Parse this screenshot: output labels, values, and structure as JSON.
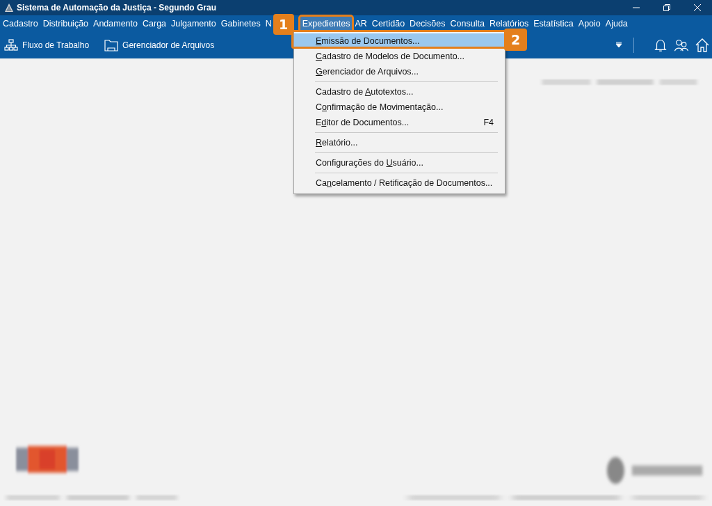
{
  "window": {
    "title": "Sistema de Automação da Justiça - Segundo Grau"
  },
  "menu_bar": [
    {
      "label": "Cadastro",
      "selected": false
    },
    {
      "label": "Distribuição",
      "selected": false
    },
    {
      "label": "Andamento",
      "selected": false
    },
    {
      "label": "Carga",
      "selected": false
    },
    {
      "label": "Julgamento",
      "selected": false
    },
    {
      "label": "Gabinetes",
      "selected": false
    },
    {
      "label": "N",
      "selected": false
    },
    {
      "label": "Expedientes",
      "selected": true
    },
    {
      "label": "AR",
      "selected": false
    },
    {
      "label": "Certidão",
      "selected": false
    },
    {
      "label": "Decisões",
      "selected": false
    },
    {
      "label": "Consulta",
      "selected": false
    },
    {
      "label": "Relatórios",
      "selected": false
    },
    {
      "label": "Estatística",
      "selected": false
    },
    {
      "label": "Apoio",
      "selected": false
    },
    {
      "label": "Ajuda",
      "selected": false
    }
  ],
  "toolbar": [
    {
      "kind": "workflow",
      "label": "Fluxo de Trabalho"
    },
    {
      "kind": "files",
      "label": "Gerenciador de Arquivos"
    }
  ],
  "dropdown_menu": [
    {
      "kind": "item",
      "key": "E",
      "post": "missão de Documentos...",
      "selected": true
    },
    {
      "kind": "item",
      "key": "C",
      "post": "adastro de Modelos de Documento...",
      "selected": false
    },
    {
      "kind": "item",
      "key": "G",
      "post": "erenciador de Arquivos...",
      "selected": false
    },
    {
      "kind": "separator"
    },
    {
      "kind": "item",
      "pre": "Cadastro de ",
      "key": "A",
      "post": "utotextos...",
      "selected": false
    },
    {
      "kind": "item",
      "pre": "C",
      "key": "o",
      "post": "nfirmação de Movimentação...",
      "selected": false
    },
    {
      "kind": "item",
      "pre": "E",
      "key": "d",
      "post": "itor de Documentos...",
      "shortcut": "F4",
      "selected": false
    },
    {
      "kind": "separator"
    },
    {
      "kind": "item",
      "key": "R",
      "post": "elatório...",
      "selected": false
    },
    {
      "kind": "separator"
    },
    {
      "kind": "item",
      "pre": "Configurações do ",
      "key": "U",
      "post": "suário...",
      "selected": false
    },
    {
      "kind": "separator"
    },
    {
      "kind": "item",
      "pre": "Ca",
      "key": "n",
      "post": "celamento / Retificação de Documentos...",
      "selected": false
    }
  ],
  "callouts": [
    {
      "number": "1"
    },
    {
      "number": "2"
    }
  ]
}
